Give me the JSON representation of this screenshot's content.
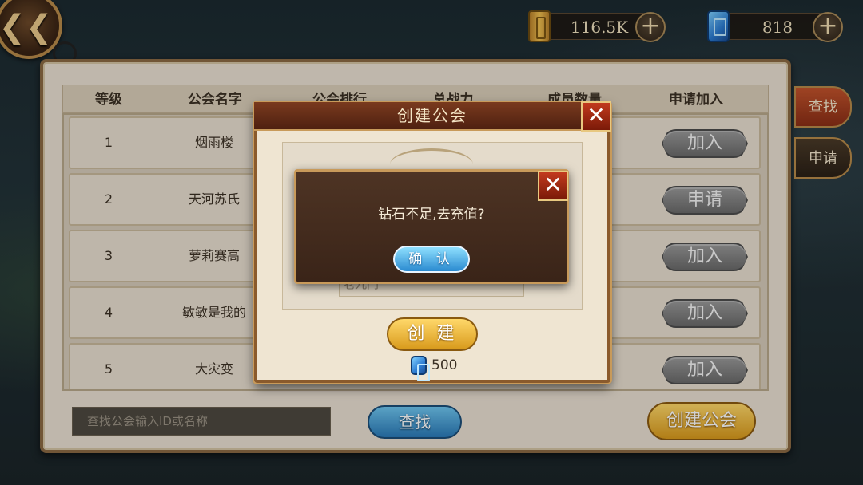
{
  "topbar": {
    "gold": "116.5K",
    "diamonds": "818"
  },
  "table": {
    "headers": [
      "等级",
      "公会名字",
      "公会排行",
      "总战力",
      "成员数量",
      "申请加入"
    ],
    "rows": [
      {
        "level": "1",
        "name": "烟雨楼",
        "action": "加入"
      },
      {
        "level": "2",
        "name": "天河苏氏",
        "action": "申请"
      },
      {
        "level": "3",
        "name": "萝莉赛高",
        "action": "加入"
      },
      {
        "level": "4",
        "name": "敏敏是我的",
        "action": "加入"
      },
      {
        "level": "5",
        "name": "大灾变",
        "action": "加入"
      }
    ]
  },
  "side_tabs": {
    "search": "查找",
    "apply": "申请"
  },
  "bottom": {
    "search_placeholder": "查找公会输入ID或名称",
    "search_button": "查找",
    "create_button": "创建公会"
  },
  "create_dialog": {
    "title": "创建公会",
    "name_value": "老九门",
    "create_button": "创 建",
    "cost": "500"
  },
  "message": {
    "text": "钻石不足,去充值?",
    "confirm": "确 认"
  }
}
